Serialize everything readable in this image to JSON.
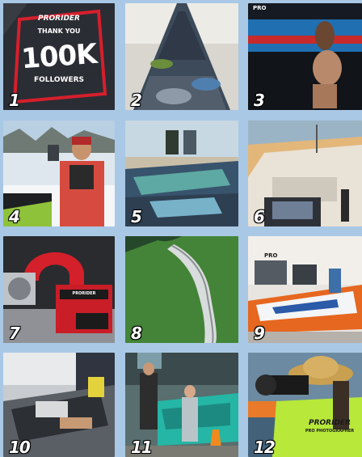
{
  "tiles": [
    {
      "number": "1",
      "brand": "PRORIDER",
      "line1": "THANK YOU",
      "big": "100K",
      "line2": "FOLLOWERS"
    },
    {
      "number": "2"
    },
    {
      "number": "3",
      "brand": "PRO"
    },
    {
      "number": "4"
    },
    {
      "number": "5"
    },
    {
      "number": "6"
    },
    {
      "number": "7",
      "brand": "PRORIDER"
    },
    {
      "number": "8"
    },
    {
      "number": "9",
      "brand": "PRO"
    },
    {
      "number": "10"
    },
    {
      "number": "11"
    },
    {
      "number": "12",
      "shirt1": "PRORIDER",
      "shirt2": "PRO PHOTOGRAPHER"
    }
  ]
}
